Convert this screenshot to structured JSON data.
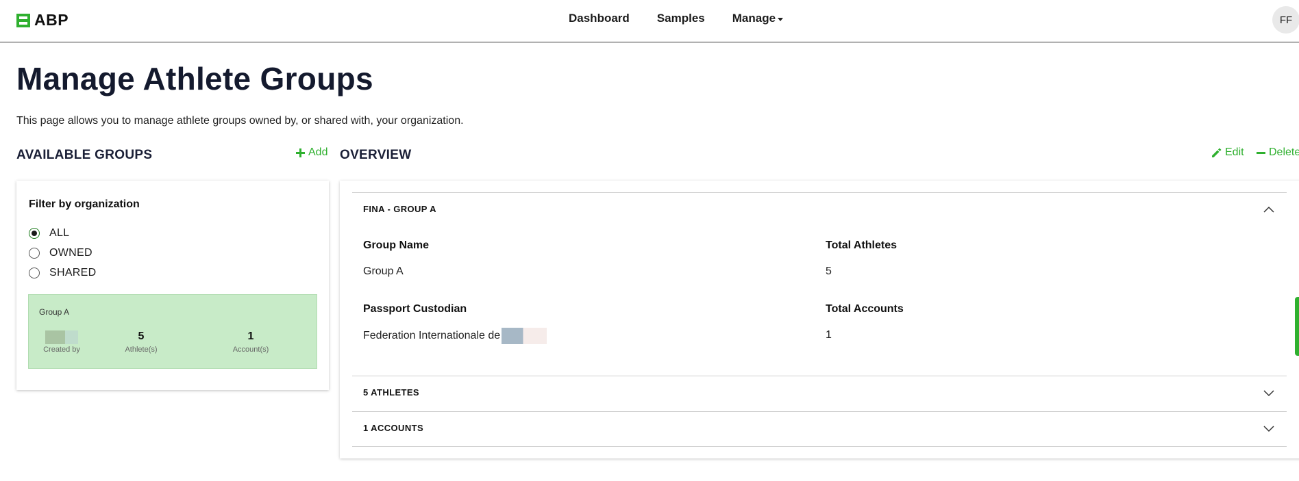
{
  "navbar": {
    "brand": "ABP",
    "links": [
      "Dashboard",
      "Samples",
      "Manage"
    ],
    "avatar_initials": "FF"
  },
  "page": {
    "title": "Manage Athlete Groups",
    "description": "This page allows you to manage athlete groups owned by, or shared with, your organization."
  },
  "available_groups": {
    "heading": "AVAILABLE GROUPS",
    "add_label": "Add",
    "filter_title": "Filter by organization",
    "filter_options": [
      {
        "label": "ALL",
        "checked": true
      },
      {
        "label": "OWNED",
        "checked": false
      },
      {
        "label": "SHARED",
        "checked": false
      }
    ],
    "group_card": {
      "name": "Group A",
      "athletes_count": "5",
      "athletes_label": "Athlete(s)",
      "accounts_count": "1",
      "accounts_label": "Account(s)",
      "created_by_label": "Created by"
    }
  },
  "overview": {
    "heading": "OVERVIEW",
    "edit_label": "Edit",
    "delete_label": "Delete",
    "sections": [
      {
        "title": "FINA - GROUP A",
        "expanded": true
      },
      {
        "title": "5 ATHLETES",
        "expanded": false
      },
      {
        "title": "1 ACCOUNTS",
        "expanded": false
      }
    ],
    "fields": {
      "group_name_label": "Group Name",
      "group_name_value": "Group A",
      "total_athletes_label": "Total Athletes",
      "total_athletes_value": "5",
      "passport_custodian_label": "Passport Custodian",
      "passport_custodian_value": "Federation Internationale de",
      "total_accounts_label": "Total Accounts",
      "total_accounts_value": "1"
    }
  },
  "colors": {
    "accent_green": "#2fb02f",
    "card_green": "#c8ebc8",
    "title_navy": "#141a2e"
  }
}
